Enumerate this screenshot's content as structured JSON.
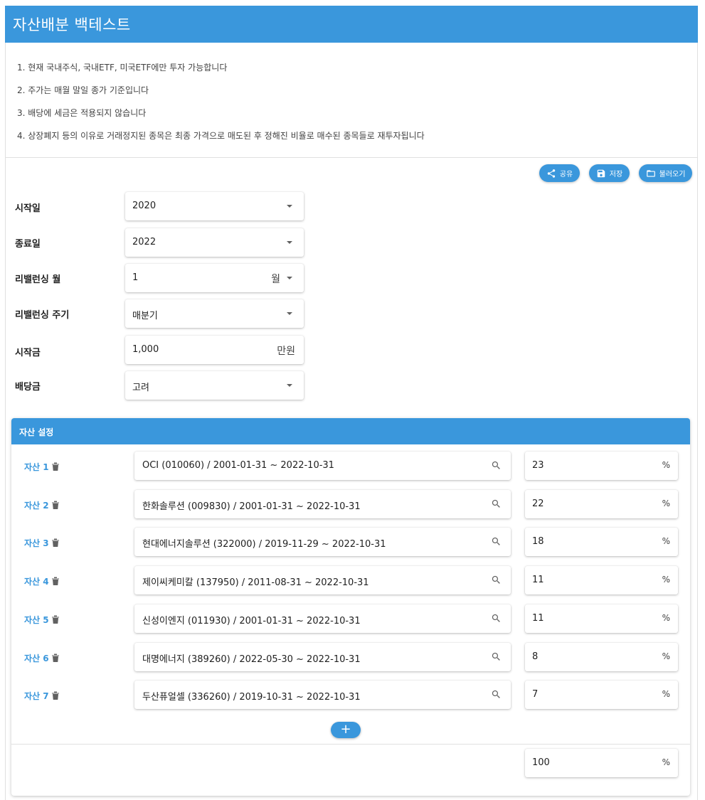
{
  "app": {
    "title": "자산배분 백테스트"
  },
  "notes": [
    "1. 현재 국내주식, 국내ETF, 미국ETF에만 투자 가능합니다",
    "2. 주가는 매월 말일 종가 기준입니다",
    "3. 배당에 세금은 적용되지 않습니다",
    "4. 상장폐지 등의 이유로 거래정지된 종목은 최종 가격으로 매도된 후 정해진 비율로 매수된 종목들로 재투자됩니다"
  ],
  "actions": {
    "share": "공유",
    "save": "저장",
    "load": "불러오기"
  },
  "form": {
    "start_label": "시작일",
    "start_value": "2020",
    "end_label": "종료일",
    "end_value": "2022",
    "rebal_month_label": "리밸런싱 월",
    "rebal_month_value": "1",
    "rebal_month_unit": "월",
    "rebal_period_label": "리밸런싱 주기",
    "rebal_period_value": "매분기",
    "capital_label": "시작금",
    "capital_value": "1,000",
    "capital_unit": "만원",
    "dividend_label": "배당금",
    "dividend_value": "고려"
  },
  "assets": {
    "title": "자산 설정",
    "items": [
      {
        "label": "자산 1",
        "stock": "OCI (010060) / 2001-01-31 ~ 2022-10-31",
        "weight": "23"
      },
      {
        "label": "자산 2",
        "stock": "한화솔루션 (009830) / 2001-01-31 ~ 2022-10-31",
        "weight": "22"
      },
      {
        "label": "자산 3",
        "stock": "현대에너지솔루션 (322000) / 2019-11-29 ~ 2022-10-31",
        "weight": "18"
      },
      {
        "label": "자산 4",
        "stock": "제이씨케미칼 (137950) / 2011-08-31 ~ 2022-10-31",
        "weight": "11"
      },
      {
        "label": "자산 5",
        "stock": "신성이엔지 (011930) / 2001-01-31 ~ 2022-10-31",
        "weight": "11"
      },
      {
        "label": "자산 6",
        "stock": "대명에너지 (389260) / 2022-05-30 ~ 2022-10-31",
        "weight": "8"
      },
      {
        "label": "자산 7",
        "stock": "두산퓨얼셀 (336260) / 2019-10-31 ~ 2022-10-31",
        "weight": "7"
      }
    ],
    "percent_unit": "%",
    "add_label": "+",
    "total_weight": "100"
  },
  "colors": {
    "primary": "#3a97dc"
  }
}
